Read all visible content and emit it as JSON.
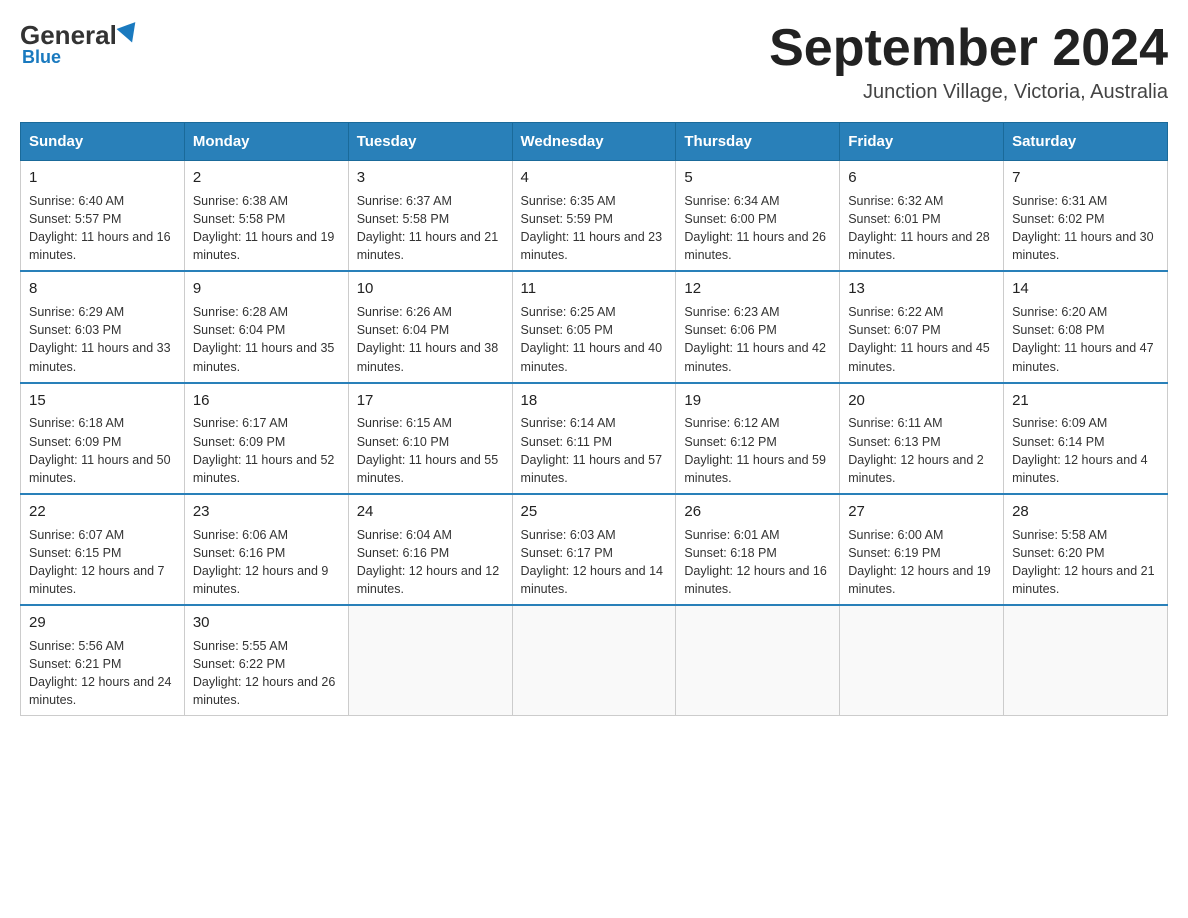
{
  "header": {
    "logo_general": "General",
    "logo_blue": "Blue",
    "month_title": "September 2024",
    "location": "Junction Village, Victoria, Australia"
  },
  "weekdays": [
    "Sunday",
    "Monday",
    "Tuesday",
    "Wednesday",
    "Thursday",
    "Friday",
    "Saturday"
  ],
  "weeks": [
    [
      {
        "day": "1",
        "sunrise": "6:40 AM",
        "sunset": "5:57 PM",
        "daylight": "11 hours and 16 minutes."
      },
      {
        "day": "2",
        "sunrise": "6:38 AM",
        "sunset": "5:58 PM",
        "daylight": "11 hours and 19 minutes."
      },
      {
        "day": "3",
        "sunrise": "6:37 AM",
        "sunset": "5:58 PM",
        "daylight": "11 hours and 21 minutes."
      },
      {
        "day": "4",
        "sunrise": "6:35 AM",
        "sunset": "5:59 PM",
        "daylight": "11 hours and 23 minutes."
      },
      {
        "day": "5",
        "sunrise": "6:34 AM",
        "sunset": "6:00 PM",
        "daylight": "11 hours and 26 minutes."
      },
      {
        "day": "6",
        "sunrise": "6:32 AM",
        "sunset": "6:01 PM",
        "daylight": "11 hours and 28 minutes."
      },
      {
        "day": "7",
        "sunrise": "6:31 AM",
        "sunset": "6:02 PM",
        "daylight": "11 hours and 30 minutes."
      }
    ],
    [
      {
        "day": "8",
        "sunrise": "6:29 AM",
        "sunset": "6:03 PM",
        "daylight": "11 hours and 33 minutes."
      },
      {
        "day": "9",
        "sunrise": "6:28 AM",
        "sunset": "6:04 PM",
        "daylight": "11 hours and 35 minutes."
      },
      {
        "day": "10",
        "sunrise": "6:26 AM",
        "sunset": "6:04 PM",
        "daylight": "11 hours and 38 minutes."
      },
      {
        "day": "11",
        "sunrise": "6:25 AM",
        "sunset": "6:05 PM",
        "daylight": "11 hours and 40 minutes."
      },
      {
        "day": "12",
        "sunrise": "6:23 AM",
        "sunset": "6:06 PM",
        "daylight": "11 hours and 42 minutes."
      },
      {
        "day": "13",
        "sunrise": "6:22 AM",
        "sunset": "6:07 PM",
        "daylight": "11 hours and 45 minutes."
      },
      {
        "day": "14",
        "sunrise": "6:20 AM",
        "sunset": "6:08 PM",
        "daylight": "11 hours and 47 minutes."
      }
    ],
    [
      {
        "day": "15",
        "sunrise": "6:18 AM",
        "sunset": "6:09 PM",
        "daylight": "11 hours and 50 minutes."
      },
      {
        "day": "16",
        "sunrise": "6:17 AM",
        "sunset": "6:09 PM",
        "daylight": "11 hours and 52 minutes."
      },
      {
        "day": "17",
        "sunrise": "6:15 AM",
        "sunset": "6:10 PM",
        "daylight": "11 hours and 55 minutes."
      },
      {
        "day": "18",
        "sunrise": "6:14 AM",
        "sunset": "6:11 PM",
        "daylight": "11 hours and 57 minutes."
      },
      {
        "day": "19",
        "sunrise": "6:12 AM",
        "sunset": "6:12 PM",
        "daylight": "11 hours and 59 minutes."
      },
      {
        "day": "20",
        "sunrise": "6:11 AM",
        "sunset": "6:13 PM",
        "daylight": "12 hours and 2 minutes."
      },
      {
        "day": "21",
        "sunrise": "6:09 AM",
        "sunset": "6:14 PM",
        "daylight": "12 hours and 4 minutes."
      }
    ],
    [
      {
        "day": "22",
        "sunrise": "6:07 AM",
        "sunset": "6:15 PM",
        "daylight": "12 hours and 7 minutes."
      },
      {
        "day": "23",
        "sunrise": "6:06 AM",
        "sunset": "6:16 PM",
        "daylight": "12 hours and 9 minutes."
      },
      {
        "day": "24",
        "sunrise": "6:04 AM",
        "sunset": "6:16 PM",
        "daylight": "12 hours and 12 minutes."
      },
      {
        "day": "25",
        "sunrise": "6:03 AM",
        "sunset": "6:17 PM",
        "daylight": "12 hours and 14 minutes."
      },
      {
        "day": "26",
        "sunrise": "6:01 AM",
        "sunset": "6:18 PM",
        "daylight": "12 hours and 16 minutes."
      },
      {
        "day": "27",
        "sunrise": "6:00 AM",
        "sunset": "6:19 PM",
        "daylight": "12 hours and 19 minutes."
      },
      {
        "day": "28",
        "sunrise": "5:58 AM",
        "sunset": "6:20 PM",
        "daylight": "12 hours and 21 minutes."
      }
    ],
    [
      {
        "day": "29",
        "sunrise": "5:56 AM",
        "sunset": "6:21 PM",
        "daylight": "12 hours and 24 minutes."
      },
      {
        "day": "30",
        "sunrise": "5:55 AM",
        "sunset": "6:22 PM",
        "daylight": "12 hours and 26 minutes."
      },
      null,
      null,
      null,
      null,
      null
    ]
  ],
  "labels": {
    "sunrise": "Sunrise:",
    "sunset": "Sunset:",
    "daylight": "Daylight:"
  }
}
